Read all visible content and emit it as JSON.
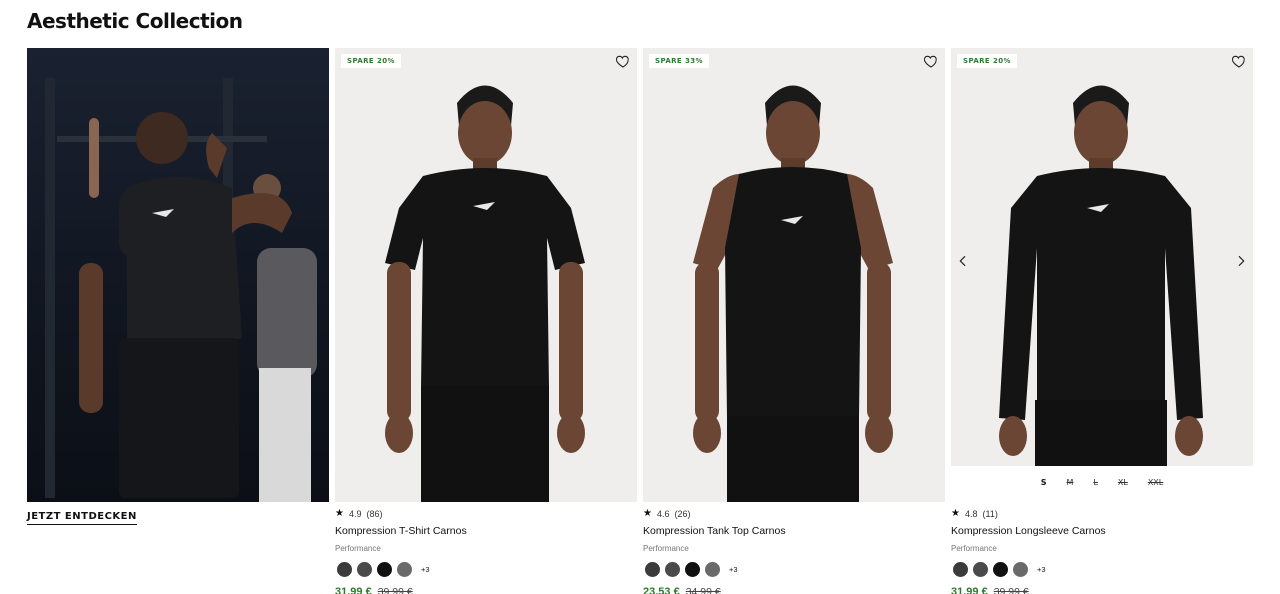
{
  "section": {
    "title": "Aesthetic Collection"
  },
  "hero": {
    "cta_label": "JETZT ENTDECKEN"
  },
  "products": [
    {
      "badge": "SPARE 20%",
      "rating": "4.9",
      "reviews": "(86)",
      "name": "Kompression T-Shirt Carnos",
      "category": "Performance",
      "swatch_colors": [
        "#3b3b3b",
        "#4a4a4a",
        "#111111",
        "#6a6a6a"
      ],
      "more_colors": "+3",
      "price": "31,99 €",
      "old_price": "39,99 €",
      "garment": "tshirt"
    },
    {
      "badge": "SPARE 33%",
      "rating": "4.6",
      "reviews": "(26)",
      "name": "Kompression Tank Top Carnos",
      "category": "Performance",
      "swatch_colors": [
        "#3b3b3b",
        "#4a4a4a",
        "#111111",
        "#6a6a6a"
      ],
      "more_colors": "+3",
      "price": "23,53 €",
      "old_price": "34,99 €",
      "garment": "tank"
    },
    {
      "badge": "SPARE 20%",
      "rating": "4.8",
      "reviews": "(11)",
      "name": "Kompression Longsleeve Carnos",
      "category": "Performance",
      "swatch_colors": [
        "#3b3b3b",
        "#4a4a4a",
        "#111111",
        "#6a6a6a"
      ],
      "more_colors": "+3",
      "price": "31,99 €",
      "old_price": "39,99 €",
      "garment": "longsleeve",
      "sizes": [
        {
          "label": "S",
          "available": true
        },
        {
          "label": "M",
          "available": false
        },
        {
          "label": "L",
          "available": false
        },
        {
          "label": "XL",
          "available": false
        },
        {
          "label": "XXL",
          "available": false
        }
      ]
    }
  ],
  "icons": {
    "wishlist": "heart-outline-icon",
    "prev": "chevron-left-icon",
    "next": "chevron-right-icon",
    "rating": "star-icon"
  },
  "colors": {
    "sale_green": "#2f7a2f",
    "card_bg": "#efeeec"
  }
}
